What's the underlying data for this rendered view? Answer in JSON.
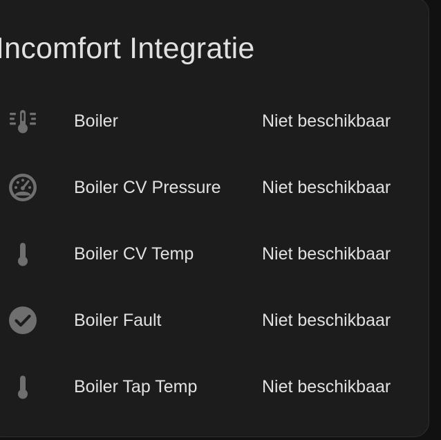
{
  "card": {
    "title": "Incomfort Integratie"
  },
  "colors": {
    "card_background": "#1c1c1c",
    "text": "#e1e1e1",
    "icon": "#6f6f6f"
  },
  "entities": [
    {
      "name": "Boiler",
      "state": "Niet beschikbaar",
      "icon": "thermometer-lines-icon"
    },
    {
      "name": "Boiler CV Pressure",
      "state": "Niet beschikbaar",
      "icon": "gauge-icon"
    },
    {
      "name": "Boiler CV Temp",
      "state": "Niet beschikbaar",
      "icon": "thermometer-icon"
    },
    {
      "name": "Boiler Fault",
      "state": "Niet beschikbaar",
      "icon": "check-circle-icon"
    },
    {
      "name": "Boiler Tap Temp",
      "state": "Niet beschikbaar",
      "icon": "thermometer-icon"
    }
  ]
}
